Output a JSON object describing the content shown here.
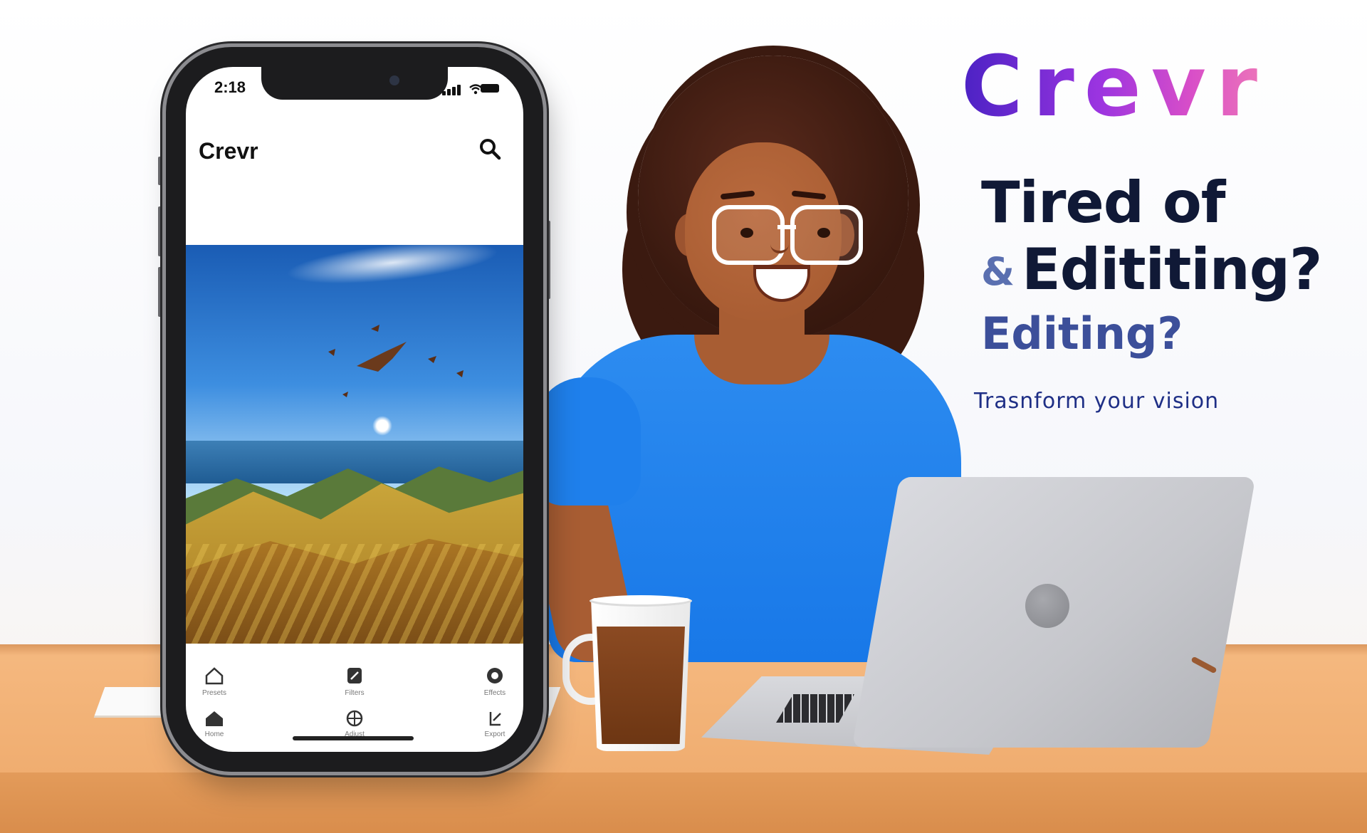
{
  "phone": {
    "status_time": "2:18",
    "app_title": "Crevr",
    "nav_top": [
      {
        "label": "Presets",
        "icon": "home-outline-icon"
      },
      {
        "label": "Filters",
        "icon": "edit-card-icon"
      },
      {
        "label": "Effects",
        "icon": "circular-sync-icon"
      }
    ],
    "nav_bottom": [
      {
        "label": "Home",
        "icon": "house-icon"
      },
      {
        "label": "Adjust",
        "icon": "globe-icon"
      },
      {
        "label": "Export",
        "icon": "share-icon"
      }
    ]
  },
  "branding": {
    "logo_text": "Crevr",
    "headline_line1": "Tired of",
    "headline_amp": "&",
    "headline_line2": "Edititing?",
    "headline_line3": "Editing?",
    "tagline": "Trasnform your vision"
  },
  "colors": {
    "brand_gradient_start": "#4b22c4",
    "brand_gradient_end": "#ee78b8",
    "headline": "#101936",
    "tagline": "#1f2f86",
    "shirt": "#1878e8",
    "desk": "#f0ad70"
  }
}
